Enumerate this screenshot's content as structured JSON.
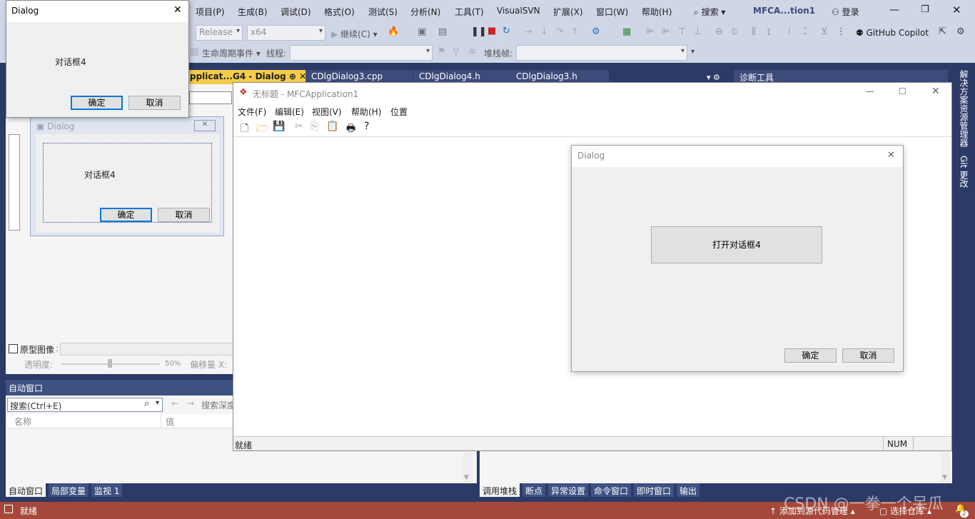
{
  "vs": {
    "menus": [
      "项目(P)",
      "生成(B)",
      "调试(D)",
      "格式(O)",
      "测试(S)",
      "分析(N)",
      "工具(T)",
      "VisualSVN",
      "扩展(X)",
      "窗口(W)",
      "帮助(H)"
    ],
    "search_label": "搜索",
    "solution_title": "MFCA...tion1",
    "login_label": "登录",
    "config_combo": "Release",
    "platform_combo": "x64",
    "continue_label": "继续(C)",
    "copilot_label": "GitHub Copilot",
    "lifecycle_label": "生命周期事件",
    "thread_label": "线程:",
    "stack_label": "堆栈帧:",
    "doc_tabs": [
      "pplicat...G4 - Dialog",
      "CDlgDialog3.cpp",
      "CDlgDialog4.h",
      "CDlgDialog3.h"
    ],
    "diag_tools": "诊断工具",
    "right_panel_labels": [
      "解决方案资源管理器",
      "Git 更改"
    ]
  },
  "designer": {
    "dialog_title": "Dialog",
    "static_text": "对话框4",
    "ok_label": "确定",
    "cancel_label": "取消",
    "proto_label": "原型图像",
    "opacity_label": "透明度:",
    "opacity_value": "50%",
    "offset_label": "偏移量 X:"
  },
  "auto_window": {
    "title": "自动窗口",
    "search_placeholder": "搜索(Ctrl+E)",
    "depth_label": "搜索深度",
    "col_name": "名称",
    "col_value": "值",
    "tabs": [
      "自动窗口",
      "局部变量",
      "监视 1"
    ]
  },
  "debug_tabs": [
    "调用堆栈",
    "断点",
    "异常设置",
    "命令窗口",
    "即时窗口",
    "输出"
  ],
  "status_bar": {
    "ready": "就绪",
    "add_source": "添加到源代码管理",
    "select_repo": "选择仓库",
    "badge": "2",
    "watermark": "CSDN @一拳一个呆瓜"
  },
  "app": {
    "title": "无标题 - MFCApplication1",
    "menus": [
      "文件(F)",
      "编辑(E)",
      "视图(V)",
      "帮助(H)",
      "位置"
    ],
    "status_ready": "就绪",
    "status_num": "NUM"
  },
  "inner_dialog": {
    "title": "Dialog",
    "open_button": "打开对话框4",
    "ok_label": "确定",
    "cancel_label": "取消"
  },
  "tl_dialog": {
    "title": "Dialog",
    "static_text": "对话框4",
    "ok_label": "确定",
    "cancel_label": "取消"
  }
}
